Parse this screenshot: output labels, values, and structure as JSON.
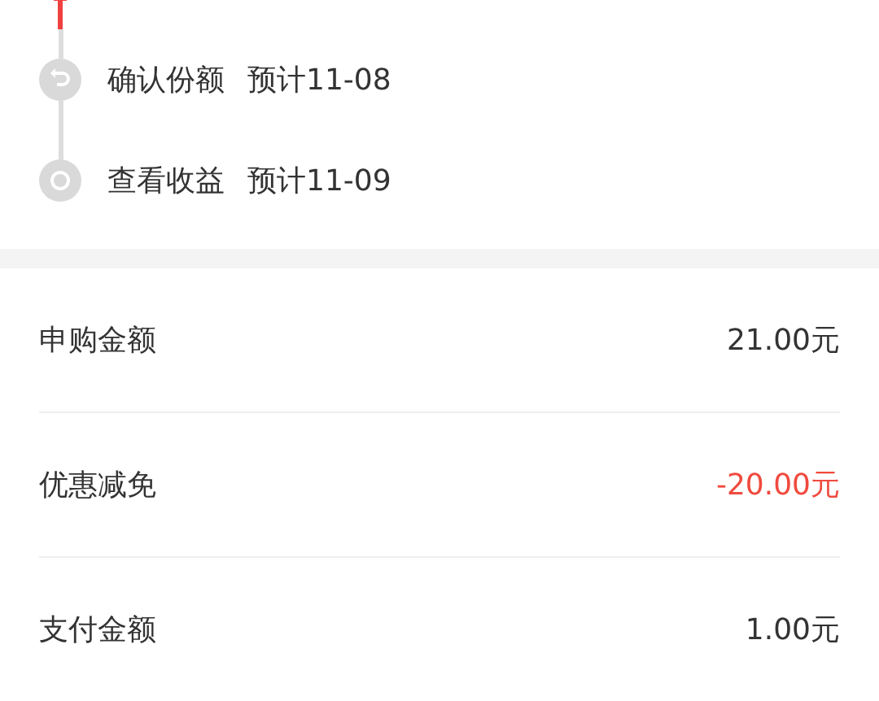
{
  "timeline": [
    {
      "kind": "return",
      "label": "确认份额",
      "date": "预计11-08"
    },
    {
      "kind": "dot",
      "label": "查看收益",
      "date": "预计11-09"
    }
  ],
  "summary": [
    {
      "kind": "normal",
      "label": "申购金额",
      "amount": "21.00元"
    },
    {
      "kind": "discount",
      "label": "优惠减免",
      "amount": "-20.00元"
    },
    {
      "kind": "normal",
      "label": "支付金额",
      "amount": "1.00元"
    }
  ]
}
